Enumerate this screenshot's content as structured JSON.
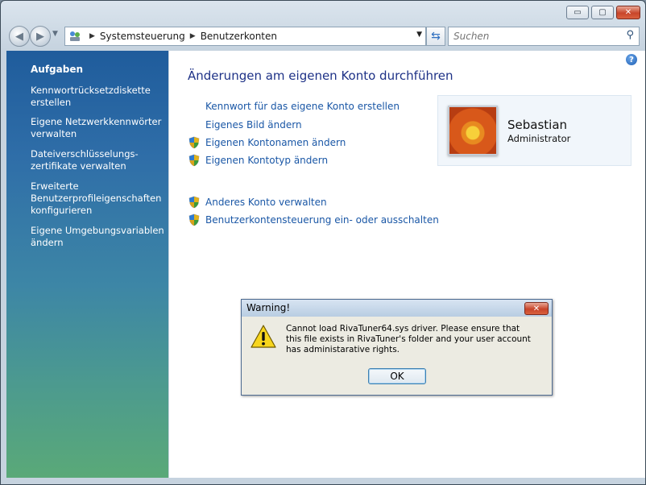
{
  "window": {
    "caption_buttons": {
      "minimize": "▭",
      "maximize": "▢",
      "close": "✕"
    }
  },
  "navigation": {
    "breadcrumb": [
      "Systemsteuerung",
      "Benutzerkonten"
    ],
    "search_placeholder": "Suchen"
  },
  "sidebar": {
    "heading": "Aufgaben",
    "tasks": [
      "Kennwortrücksetzdiskette erstellen",
      "Eigene Netzwerkkennwörter verwalten",
      "Dateiverschlüsselungs-zertifikate verwalten",
      "Erweiterte Benutzerprofileigenschaften konfigurieren",
      "Eigene Umgebungsvariablen ändern"
    ]
  },
  "main": {
    "title": "Änderungen am eigenen Konto durchführen",
    "links": [
      "Kennwort für das eigene Konto erstellen",
      "Eigenes Bild ändern",
      "Eigenen Kontonamen ändern",
      "Eigenen Kontotyp ändern",
      "Anderes Konto verwalten",
      "Benutzerkontensteuerung ein- oder ausschalten"
    ],
    "user": {
      "name": "Sebastian",
      "role": "Administrator"
    }
  },
  "dialog": {
    "title": "Warning!",
    "message": "Cannot load RivaTuner64.sys driver. Please ensure that this file exists in RivaTuner's folder and your user account has administarative rights.",
    "ok_label": "OK"
  },
  "colors": {
    "link": "#1a57a6",
    "title": "#1e3287",
    "sidebar_top": "#1f5c9c",
    "sidebar_bottom": "#5aa978"
  }
}
